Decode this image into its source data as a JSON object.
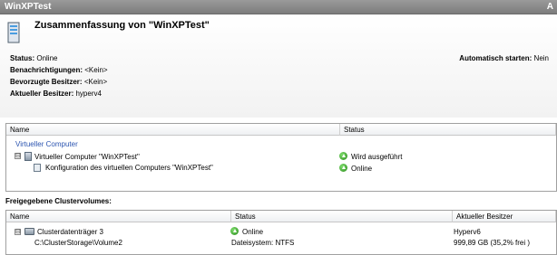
{
  "window": {
    "title": "WinXPTest",
    "collapse_glyph": "A"
  },
  "summary": {
    "heading": "Zusammenfassung von \"WinXPTest\"",
    "icon": "server-icon",
    "status_label": "Status:",
    "status_value": "Online",
    "notifications_label": "Benachrichtigungen:",
    "notifications_value": "<Kein>",
    "preferred_owners_label": "Bevorzugte Besitzer:",
    "preferred_owners_value": "<Kein>",
    "current_owner_label": "Aktueller Besitzer:",
    "current_owner_value": "hyperv4",
    "autostart_label": "Automatisch starten:",
    "autostart_value": "Nein"
  },
  "resources": {
    "columns": [
      "Name",
      "Status"
    ],
    "group_label": "Virtueller Computer",
    "rows": [
      {
        "name": "Virtueller Computer \"WinXPTest\"",
        "status": "Wird ausgeführt",
        "icon": "virtual-machine-icon",
        "toggle": "⊟"
      },
      {
        "name": "Konfiguration des virtuellen Computers \"WinXPTest\"",
        "status": "Online",
        "icon": "configuration-icon"
      }
    ]
  },
  "volumes": {
    "section_label": "Freigegebene Clustervolumes:",
    "columns": [
      "Name",
      "Status",
      "Aktueller Besitzer"
    ],
    "rows": [
      {
        "name": "Clusterdatenträger 3",
        "status": "Online",
        "owner": "Hyperv6",
        "path": "C:\\ClusterStorage\\Volume2",
        "filesystem": "Dateisystem: NTFS",
        "capacity": "999,89 GB (35,2% frei )",
        "icon": "cluster-disk-icon",
        "toggle": "⊟"
      }
    ]
  },
  "colors": {
    "group_label": "#2b54b0",
    "status_ok": "#2a8a1c",
    "titlebar": "#8a8a8a"
  }
}
